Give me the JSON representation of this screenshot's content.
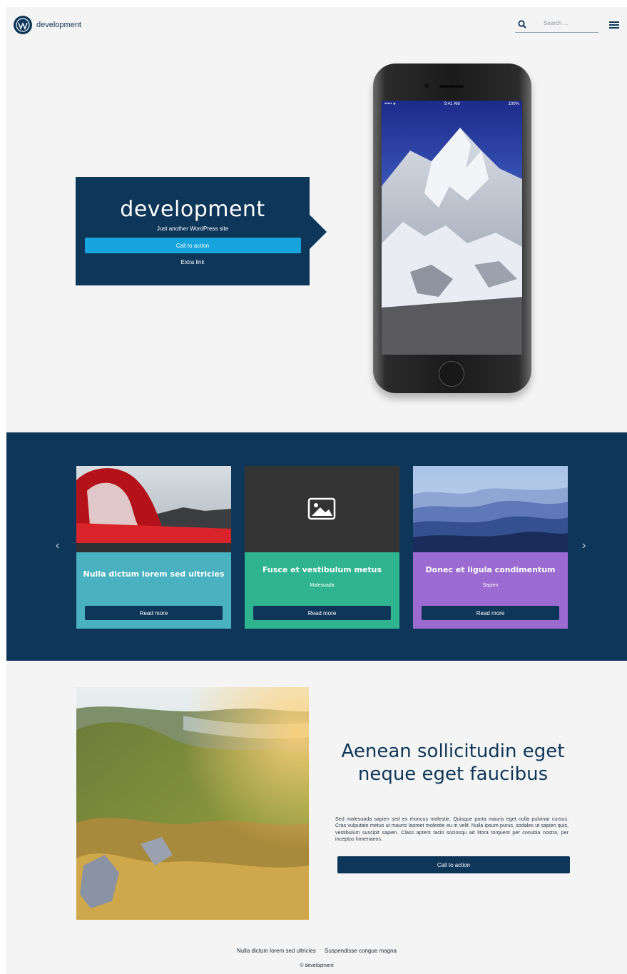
{
  "header": {
    "site_name": "development",
    "search_placeholder": "Search ..."
  },
  "hero": {
    "title": "development",
    "tagline": "Just another WordPress site",
    "cta_label": "Call to action",
    "extra_link": "Extra link",
    "phone_time": "9:41 AM",
    "phone_carrier": "••••• ●",
    "phone_battery": "100%"
  },
  "carousel": {
    "prev_icon": "‹",
    "next_icon": "›",
    "cards": [
      {
        "title": "Nulla dictum lorem sed ultricies",
        "subtitle": "",
        "button": "Read more",
        "color": "#49b1c0",
        "image": "lava"
      },
      {
        "title": "Fusce et vestibulum metus",
        "subtitle": "Malesuada",
        "button": "Read more",
        "color": "#2fb48f",
        "image": "placeholder-icon"
      },
      {
        "title": "Donec et ligula condimentum",
        "subtitle": "Sapien",
        "button": "Read more",
        "color": "#9b6bd1",
        "image": "mountains"
      }
    ]
  },
  "feature": {
    "title": "Aenean sollicitudin eget neque eget faucibus",
    "text": "Sed malesuada sapien sed ex rhoncus molestie. Quisque porta mauris eget nulla pulvinar cursus. Cras vulputate metus ut mauris laoreet molestie eu in velit. Nulla ipsum purus, sodales ut sapien quis, vestibulum suscipit sapien. Class aptent taciti sociosqu ad litora torquent per conubia nostra, per inceptos himenaeos.",
    "cta_label": "Call to action"
  },
  "footer": {
    "links": [
      "Nulla dictum lorem sed ultricies",
      "Suspendisse congue magna"
    ],
    "copyright": "© development"
  },
  "colors": {
    "navy": "#0e3659",
    "accent": "#17a3dc",
    "page_bg": "#f4f4f4"
  }
}
